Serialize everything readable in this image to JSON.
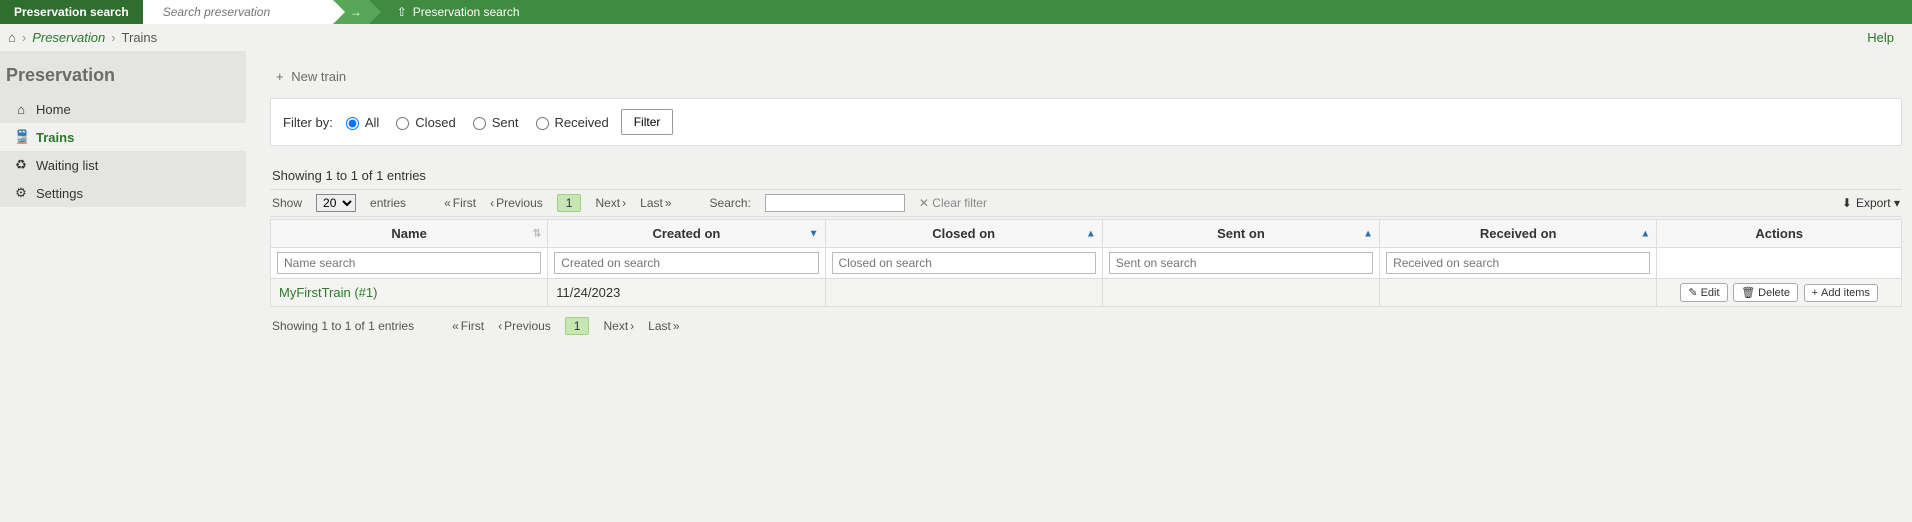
{
  "topbar": {
    "label": "Preservation search",
    "placeholder": "Search preservation",
    "link_label": "Preservation search"
  },
  "breadcrumbs": {
    "module": "Preservation",
    "page": "Trains",
    "help": "Help"
  },
  "sidebar": {
    "title": "Preservation",
    "items": [
      {
        "label": "Home"
      },
      {
        "label": "Trains"
      },
      {
        "label": "Waiting list"
      },
      {
        "label": "Settings"
      }
    ]
  },
  "toolbar": {
    "new_train": "New train"
  },
  "filter": {
    "label": "Filter by:",
    "options": {
      "all": "All",
      "closed": "Closed",
      "sent": "Sent",
      "received": "Received"
    },
    "selected": "all",
    "button": "Filter"
  },
  "table": {
    "showing": "Showing 1 to 1 of 1 entries",
    "show_label": "Show",
    "entries_label": "entries",
    "page_size": "20",
    "nav": {
      "first": "First",
      "prev": "Previous",
      "page": "1",
      "next": "Next",
      "last": "Last"
    },
    "search_label": "Search:",
    "clear_filter": "Clear filter",
    "export": "Export ▾",
    "columns": {
      "name": "Name",
      "created": "Created on",
      "closed": "Closed on",
      "sent": "Sent on",
      "received": "Received on",
      "actions": "Actions"
    },
    "filters_ph": {
      "name": "Name search",
      "created": "Created on search",
      "closed": "Closed on search",
      "sent": "Sent on search",
      "received": "Received on search"
    },
    "rows": [
      {
        "name": "MyFirstTrain (#1)",
        "created": "11/24/2023",
        "closed": "",
        "sent": "",
        "received": ""
      }
    ],
    "actions": {
      "edit": "Edit",
      "delete": "Delete",
      "add_items": "Add items"
    }
  }
}
